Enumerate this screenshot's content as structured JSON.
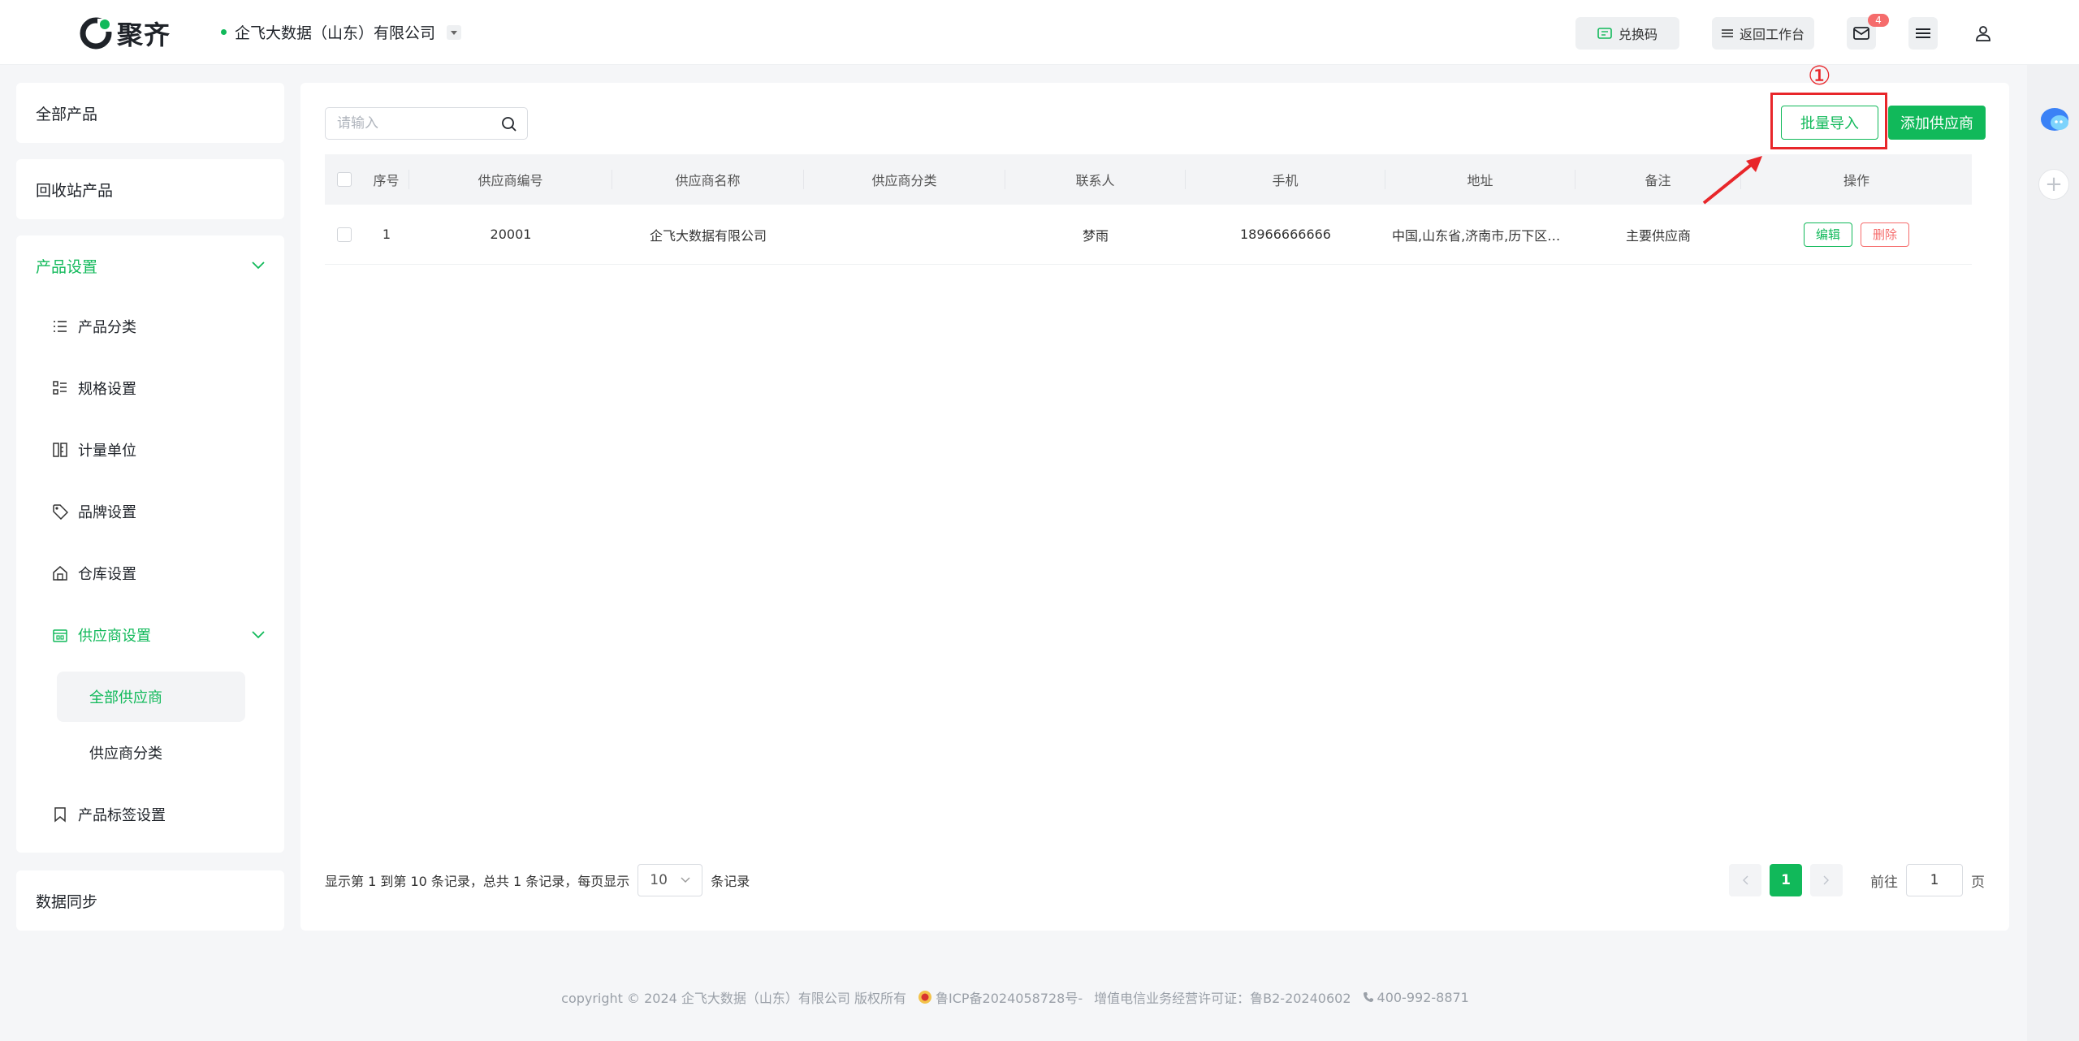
{
  "header": {
    "logo_text": "聚齐",
    "org_name": "企飞大数据（山东）有限公司",
    "redeem_label": "兑换码",
    "back_label": "返回工作台",
    "mail_badge": "4",
    "icons": [
      "ticket-icon",
      "list-icon",
      "mail-icon",
      "menu-icon",
      "user-icon"
    ]
  },
  "sidebar": {
    "all_products": "全部产品",
    "recycle_products": "回收站产品",
    "product_settings": {
      "title": "产品设置",
      "items": [
        {
          "label": "产品分类",
          "icon": "list-icon"
        },
        {
          "label": "规格设置",
          "icon": "spec-icon"
        },
        {
          "label": "计量单位",
          "icon": "unit-icon"
        },
        {
          "label": "品牌设置",
          "icon": "tag-icon"
        },
        {
          "label": "仓库设置",
          "icon": "warehouse-icon"
        }
      ],
      "supplier": {
        "label": "供应商设置",
        "sub": [
          {
            "label": "全部供应商",
            "selected": true
          },
          {
            "label": "供应商分类",
            "selected": false
          }
        ]
      },
      "tag_settings": "产品标签设置"
    },
    "data_sync": "数据同步"
  },
  "toolbar": {
    "search_placeholder": "请输入",
    "import_label": "批量导入",
    "add_label": "添加供应商",
    "annotation_number": "①"
  },
  "table": {
    "columns": [
      "序号",
      "供应商编号",
      "供应商名称",
      "供应商分类",
      "联系人",
      "手机",
      "地址",
      "备注",
      "操作"
    ],
    "rows": [
      {
        "no": "1",
        "code": "20001",
        "name": "企飞大数据有限公司",
        "category": "",
        "contact": "梦雨",
        "phone": "18966666666",
        "address": "中国,山东省,济南市,历下区红…",
        "note": "主要供应商",
        "edit": "编辑",
        "delete": "删除"
      }
    ]
  },
  "pagination": {
    "info_prefix": "显示第 1 到第 10 条记录，总共 1 条记录，每页显示",
    "page_size": "10",
    "info_suffix": "条记录",
    "current_page": "1",
    "goto_label": "前往",
    "goto_value": "1",
    "page_unit": "页"
  },
  "footer": {
    "copyright": "copyright © 2024 企飞大数据（山东）有限公司 版权所有",
    "icp": "鲁ICP备2024058728号-",
    "license": "增值电信业务经营许可证：鲁B2-20240602",
    "phone": "400-992-8871"
  },
  "colors": {
    "accent": "#11b95a",
    "danger": "#f56c6c",
    "annotation": "#e8262a"
  }
}
